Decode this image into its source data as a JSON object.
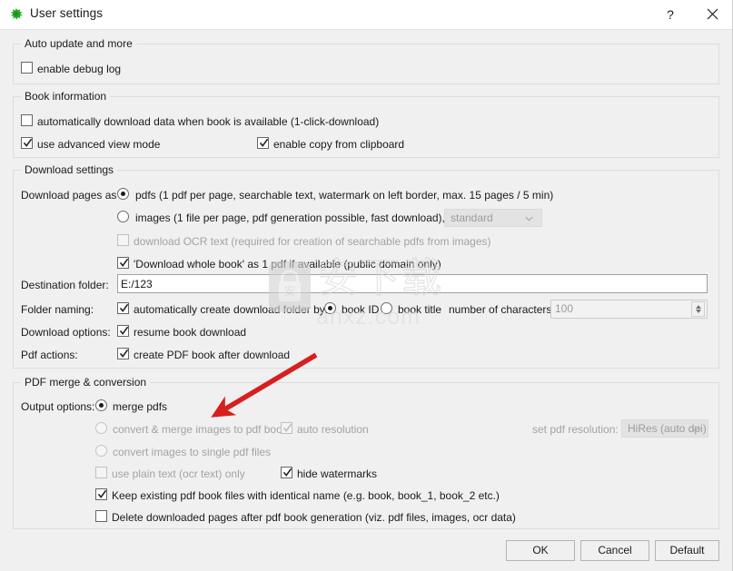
{
  "window": {
    "title": "User settings",
    "icon": "green-splat-icon",
    "help_label": "?",
    "close_label": "×"
  },
  "groups": {
    "auto_update": {
      "title": "Auto update and more",
      "enable_debug_log": {
        "label": "enable debug log",
        "checked": false
      }
    },
    "book_information": {
      "title": "Book information",
      "auto_download": {
        "label": "automatically download data when book is available (1-click-download)",
        "checked": false
      },
      "advanced_view": {
        "label": "use advanced view mode",
        "checked": true
      },
      "copy_clipboard": {
        "label": "enable copy from clipboard",
        "checked": true
      }
    },
    "download_settings": {
      "title": "Download settings",
      "download_pages_as_label": "Download pages as",
      "pdfs_option": {
        "label": "pdfs (1 pdf per page, searchable text,  watermark on left border,  max. 15 pages / 5 min)",
        "selected": true
      },
      "images_option": {
        "label": "images (1 file per page, pdf generation possible, fast download), image",
        "selected": false
      },
      "image_quality": {
        "value": "standard",
        "enabled": false
      },
      "ocr_text": {
        "label": "download OCR text (required for creation of searchable pdfs from images)",
        "checked": false,
        "enabled": false
      },
      "whole_book": {
        "label": "'Download whole book' as 1 pdf if available (public domain only)",
        "checked": true
      },
      "destination_folder_label": "Destination folder:",
      "destination_folder_value": "E:/123",
      "folder_naming_label": "Folder naming:",
      "auto_create_folder": {
        "label": "automatically create download folder by:",
        "checked": true
      },
      "book_id_option": {
        "label": "book ID",
        "selected": true
      },
      "book_title_option": {
        "label": "book title",
        "selected": false
      },
      "number_of_characters_label": "number of characters",
      "number_of_characters_value": "100",
      "download_options_label": "Download options:",
      "resume_download": {
        "label": "resume book download",
        "checked": true
      },
      "pdf_actions_label": "Pdf actions:",
      "create_pdf_after": {
        "label": "create PDF book after download",
        "checked": true
      }
    },
    "pdf_merge": {
      "title": "PDF merge & conversion",
      "output_options_label": "Output options:",
      "merge_pdfs": {
        "label": "merge pdfs",
        "selected": true
      },
      "convert_merge_images": {
        "label": "convert & merge images to pdf book",
        "selected": false,
        "enabled": false
      },
      "auto_resolution": {
        "label": "auto resolution",
        "checked": true,
        "enabled": false
      },
      "set_pdf_resolution_label": "set pdf resolution:",
      "pdf_resolution_value": "HiRes (auto dpi)",
      "convert_single_files": {
        "label": "convert images to single pdf files",
        "selected": false,
        "enabled": false
      },
      "plain_text_only": {
        "label": "use plain text (ocr text) only",
        "checked": false,
        "enabled": false
      },
      "hide_watermarks": {
        "label": "hide watermarks",
        "checked": true
      },
      "keep_existing": {
        "label": "Keep existing pdf book files with identical name (e.g. book, book_1, book_2 etc.)",
        "checked": true
      },
      "delete_downloaded": {
        "label": "Delete downloaded pages after pdf book generation (viz. pdf files, images, ocr data)",
        "checked": false
      }
    }
  },
  "footer": {
    "ok_label": "OK",
    "cancel_label": "Cancel",
    "default_label": "Default"
  },
  "watermark": {
    "chinese_text": "安下载",
    "domain_text": "anxz.com",
    "badge_char": "安"
  },
  "colors": {
    "dialog_bg": "#f0f0f0",
    "titlebar_bg": "#ffffff",
    "group_border": "#dcdcdc",
    "text": "#1a1a1a",
    "disabled_text": "#a3a3a3",
    "annotation_red": "#d81f1f"
  }
}
